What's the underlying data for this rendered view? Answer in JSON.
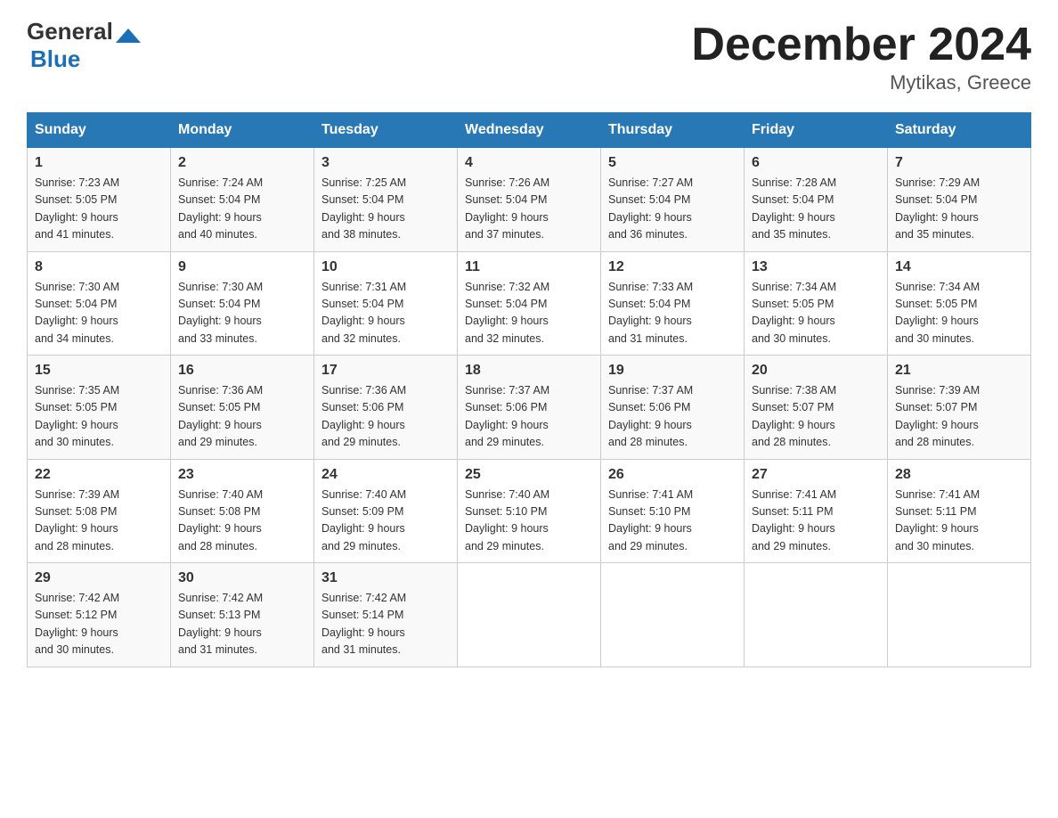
{
  "header": {
    "month_year": "December 2024",
    "location": "Mytikas, Greece",
    "logo_general": "General",
    "logo_blue": "Blue"
  },
  "columns": [
    "Sunday",
    "Monday",
    "Tuesday",
    "Wednesday",
    "Thursday",
    "Friday",
    "Saturday"
  ],
  "weeks": [
    [
      {
        "day": "1",
        "sunrise": "7:23 AM",
        "sunset": "5:05 PM",
        "daylight": "9 hours and 41 minutes."
      },
      {
        "day": "2",
        "sunrise": "7:24 AM",
        "sunset": "5:04 PM",
        "daylight": "9 hours and 40 minutes."
      },
      {
        "day": "3",
        "sunrise": "7:25 AM",
        "sunset": "5:04 PM",
        "daylight": "9 hours and 38 minutes."
      },
      {
        "day": "4",
        "sunrise": "7:26 AM",
        "sunset": "5:04 PM",
        "daylight": "9 hours and 37 minutes."
      },
      {
        "day": "5",
        "sunrise": "7:27 AM",
        "sunset": "5:04 PM",
        "daylight": "9 hours and 36 minutes."
      },
      {
        "day": "6",
        "sunrise": "7:28 AM",
        "sunset": "5:04 PM",
        "daylight": "9 hours and 35 minutes."
      },
      {
        "day": "7",
        "sunrise": "7:29 AM",
        "sunset": "5:04 PM",
        "daylight": "9 hours and 35 minutes."
      }
    ],
    [
      {
        "day": "8",
        "sunrise": "7:30 AM",
        "sunset": "5:04 PM",
        "daylight": "9 hours and 34 minutes."
      },
      {
        "day": "9",
        "sunrise": "7:30 AM",
        "sunset": "5:04 PM",
        "daylight": "9 hours and 33 minutes."
      },
      {
        "day": "10",
        "sunrise": "7:31 AM",
        "sunset": "5:04 PM",
        "daylight": "9 hours and 32 minutes."
      },
      {
        "day": "11",
        "sunrise": "7:32 AM",
        "sunset": "5:04 PM",
        "daylight": "9 hours and 32 minutes."
      },
      {
        "day": "12",
        "sunrise": "7:33 AM",
        "sunset": "5:04 PM",
        "daylight": "9 hours and 31 minutes."
      },
      {
        "day": "13",
        "sunrise": "7:34 AM",
        "sunset": "5:05 PM",
        "daylight": "9 hours and 30 minutes."
      },
      {
        "day": "14",
        "sunrise": "7:34 AM",
        "sunset": "5:05 PM",
        "daylight": "9 hours and 30 minutes."
      }
    ],
    [
      {
        "day": "15",
        "sunrise": "7:35 AM",
        "sunset": "5:05 PM",
        "daylight": "9 hours and 30 minutes."
      },
      {
        "day": "16",
        "sunrise": "7:36 AM",
        "sunset": "5:05 PM",
        "daylight": "9 hours and 29 minutes."
      },
      {
        "day": "17",
        "sunrise": "7:36 AM",
        "sunset": "5:06 PM",
        "daylight": "9 hours and 29 minutes."
      },
      {
        "day": "18",
        "sunrise": "7:37 AM",
        "sunset": "5:06 PM",
        "daylight": "9 hours and 29 minutes."
      },
      {
        "day": "19",
        "sunrise": "7:37 AM",
        "sunset": "5:06 PM",
        "daylight": "9 hours and 28 minutes."
      },
      {
        "day": "20",
        "sunrise": "7:38 AM",
        "sunset": "5:07 PM",
        "daylight": "9 hours and 28 minutes."
      },
      {
        "day": "21",
        "sunrise": "7:39 AM",
        "sunset": "5:07 PM",
        "daylight": "9 hours and 28 minutes."
      }
    ],
    [
      {
        "day": "22",
        "sunrise": "7:39 AM",
        "sunset": "5:08 PM",
        "daylight": "9 hours and 28 minutes."
      },
      {
        "day": "23",
        "sunrise": "7:40 AM",
        "sunset": "5:08 PM",
        "daylight": "9 hours and 28 minutes."
      },
      {
        "day": "24",
        "sunrise": "7:40 AM",
        "sunset": "5:09 PM",
        "daylight": "9 hours and 29 minutes."
      },
      {
        "day": "25",
        "sunrise": "7:40 AM",
        "sunset": "5:10 PM",
        "daylight": "9 hours and 29 minutes."
      },
      {
        "day": "26",
        "sunrise": "7:41 AM",
        "sunset": "5:10 PM",
        "daylight": "9 hours and 29 minutes."
      },
      {
        "day": "27",
        "sunrise": "7:41 AM",
        "sunset": "5:11 PM",
        "daylight": "9 hours and 29 minutes."
      },
      {
        "day": "28",
        "sunrise": "7:41 AM",
        "sunset": "5:11 PM",
        "daylight": "9 hours and 30 minutes."
      }
    ],
    [
      {
        "day": "29",
        "sunrise": "7:42 AM",
        "sunset": "5:12 PM",
        "daylight": "9 hours and 30 minutes."
      },
      {
        "day": "30",
        "sunrise": "7:42 AM",
        "sunset": "5:13 PM",
        "daylight": "9 hours and 31 minutes."
      },
      {
        "day": "31",
        "sunrise": "7:42 AM",
        "sunset": "5:14 PM",
        "daylight": "9 hours and 31 minutes."
      },
      null,
      null,
      null,
      null
    ]
  ],
  "labels": {
    "sunrise": "Sunrise:",
    "sunset": "Sunset:",
    "daylight": "Daylight:"
  }
}
